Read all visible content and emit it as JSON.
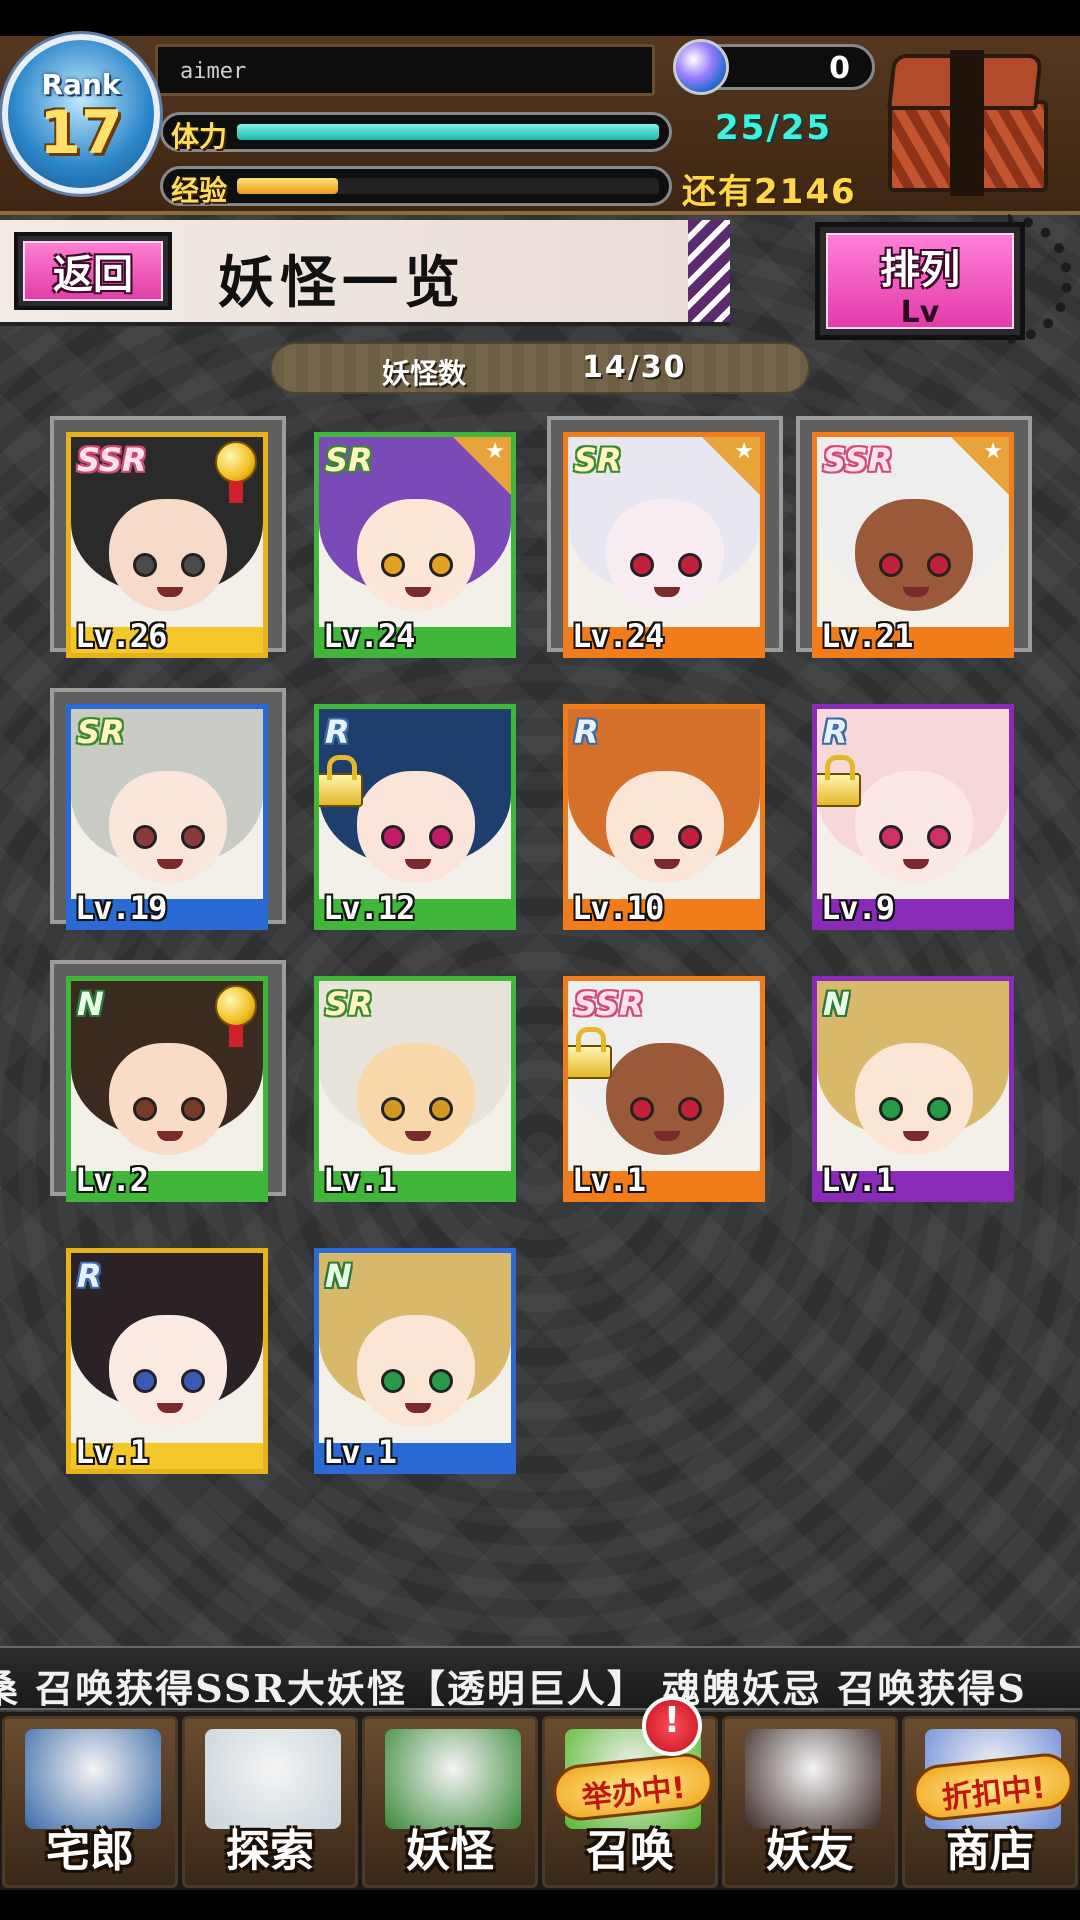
{
  "player": {
    "rank_label": "Rank",
    "rank": "17",
    "name": "aimer",
    "orb_count": "0",
    "stamina_label": "体力",
    "stamina_value": "25/25",
    "stamina_fraction": 1.0,
    "exp_label": "经验",
    "exp_remaining": "还有2146",
    "exp_fraction": 0.24
  },
  "header": {
    "back_label": "返回",
    "title": "妖怪一览",
    "sort_label": "排列",
    "sort_value": "Lv"
  },
  "summary": {
    "count_label": "妖怪数",
    "count_value": "14/30"
  },
  "cards": [
    {
      "rarity": "SSR",
      "level": "Lv.26",
      "frame": "#e8b21a",
      "band": "#f5c72a",
      "hair": "#2a2a2a",
      "skin": "#f6dcc8",
      "eye": "#4a4a4a",
      "medal": true,
      "star": false,
      "lock": false,
      "selected": true
    },
    {
      "rarity": "SR",
      "level": "Lv.24",
      "frame": "#3fb83a",
      "band": "#3fb83a",
      "hair": "#7a4bb8",
      "skin": "#fbe6d8",
      "eye": "#e2a420",
      "medal": false,
      "star": true,
      "lock": false,
      "selected": false
    },
    {
      "rarity": "SR",
      "level": "Lv.24",
      "frame": "#f07c1a",
      "band": "#f07c1a",
      "hair": "#e8e6f0",
      "skin": "#f6ecf2",
      "eye": "#c2203a",
      "medal": false,
      "star": true,
      "lock": false,
      "selected": true
    },
    {
      "rarity": "SSR",
      "level": "Lv.21",
      "frame": "#f07c1a",
      "band": "#f07c1a",
      "hair": "#eeeeee",
      "skin": "#9a5a3a",
      "eye": "#c2203a",
      "medal": false,
      "star": true,
      "lock": false,
      "selected": true
    },
    {
      "rarity": "SR",
      "level": "Lv.19",
      "frame": "#2a6ad4",
      "band": "#2a6ad4",
      "hair": "#c8ccc4",
      "skin": "#fae6da",
      "eye": "#8a3a3a",
      "medal": false,
      "star": false,
      "lock": false,
      "selected": true
    },
    {
      "rarity": "R",
      "level": "Lv.12",
      "frame": "#3fb83a",
      "band": "#3fb83a",
      "hair": "#1e3f6e",
      "skin": "#fbe4da",
      "eye": "#c21a6a",
      "medal": false,
      "star": false,
      "lock": true,
      "selected": false
    },
    {
      "rarity": "R",
      "level": "Lv.10",
      "frame": "#f07c1a",
      "band": "#f07c1a",
      "hair": "#d4702a",
      "skin": "#fbe6d6",
      "eye": "#c2203a",
      "medal": false,
      "star": false,
      "lock": false,
      "selected": false
    },
    {
      "rarity": "R",
      "level": "Lv.9",
      "frame": "#8a2ab8",
      "band": "#8a2ab8",
      "hair": "#f6d8d8",
      "skin": "#fbe8e4",
      "eye": "#d0306a",
      "medal": false,
      "star": false,
      "lock": true,
      "selected": false
    },
    {
      "rarity": "N",
      "level": "Lv.2",
      "frame": "#3fb83a",
      "band": "#3fb83a",
      "hair": "#3a2a20",
      "skin": "#f8dcc8",
      "eye": "#7a3a2a",
      "medal": true,
      "star": false,
      "lock": false,
      "selected": true
    },
    {
      "rarity": "SR",
      "level": "Lv.1",
      "frame": "#3fb83a",
      "band": "#3fb83a",
      "hair": "#e8e4dc",
      "skin": "#f8d8a8",
      "eye": "#d09a20",
      "medal": false,
      "star": false,
      "lock": false,
      "selected": false
    },
    {
      "rarity": "SSR",
      "level": "Lv.1",
      "frame": "#f07c1a",
      "band": "#f07c1a",
      "hair": "#eeeeee",
      "skin": "#9a5a3a",
      "eye": "#c2203a",
      "medal": false,
      "star": false,
      "lock": true,
      "selected": false
    },
    {
      "rarity": "N",
      "level": "Lv.1",
      "frame": "#8a2ab8",
      "band": "#8a2ab8",
      "hair": "#d8b86a",
      "skin": "#fbe6d6",
      "eye": "#2a9a4a",
      "medal": false,
      "star": false,
      "lock": false,
      "selected": false
    },
    {
      "rarity": "R",
      "level": "Lv.1",
      "frame": "#e8b21a",
      "band": "#f5c72a",
      "hair": "#2a2226",
      "skin": "#fbeae2",
      "eye": "#3a5ab8",
      "medal": false,
      "star": false,
      "lock": false,
      "selected": false
    },
    {
      "rarity": "N",
      "level": "Lv.1",
      "frame": "#2a6ad4",
      "band": "#2a6ad4",
      "hair": "#d8b86a",
      "skin": "#fbe6d6",
      "eye": "#2a9a4a",
      "medal": false,
      "star": false,
      "lock": false,
      "selected": false
    }
  ],
  "ticker": {
    "text": "桑 召唤获得SSR大妖怪【透明巨人】    魂魄妖忌 召唤获得S"
  },
  "nav": [
    {
      "label": "宅郎",
      "icon": "house-icon",
      "badge": "",
      "color": "#3a6aa8"
    },
    {
      "label": "探索",
      "icon": "magnifier-icon",
      "badge": "",
      "color": "#c8d4dc"
    },
    {
      "label": "妖怪",
      "icon": "scroll-icon",
      "badge": "",
      "color": "#3a8a3a"
    },
    {
      "label": "召唤",
      "icon": "summon-star-icon",
      "badge": "举办中!",
      "color": "#58b830"
    },
    {
      "label": "妖友",
      "icon": "friend-icon",
      "badge": "",
      "color": "#3a2a26"
    },
    {
      "label": "商店",
      "icon": "shop-orb-icon",
      "badge": "折扣中!",
      "color": "#6a8ad8"
    }
  ],
  "alert": "!"
}
